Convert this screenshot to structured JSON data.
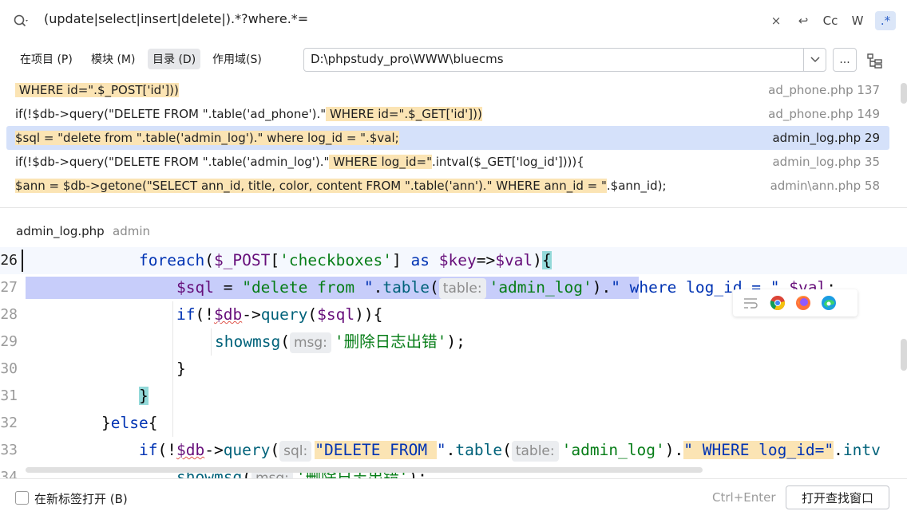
{
  "search": {
    "query": "(update|select|insert|delete|).*?where.*=",
    "actions": {
      "clear": "×",
      "replace": "↩",
      "match_case": "Cc",
      "whole_words": "W",
      "regex": ".*"
    }
  },
  "scope": {
    "tabs": [
      {
        "label": "在项目 (P)",
        "selected": false
      },
      {
        "label": "模块 (M)",
        "selected": false
      },
      {
        "label": "目录 (D)",
        "selected": true
      },
      {
        "label": "作用域(S)",
        "selected": false
      }
    ],
    "directory": "D:\\phpstudy_pro\\WWW\\bluecms",
    "browse_label": "..."
  },
  "results": [
    {
      "pre": "",
      "hl": " WHERE id=\".$_POST['id']))",
      "post": "",
      "file": "ad_phone.php 137",
      "selected": false
    },
    {
      "pre": "if(!$db->query(\"DELETE FROM \".table('ad_phone').\"",
      "hl": " WHERE id=\".$_GET['id']))",
      "post": "",
      "file": "ad_phone.php 149",
      "selected": false
    },
    {
      "pre": "",
      "hl": "$sql = \"delete from \".table('admin_log').\" where log_id = \".$val;",
      "post": "",
      "file": "admin_log.php 29",
      "selected": true
    },
    {
      "pre": "if(!$db->query(\"DELETE FROM \".table('admin_log').\"",
      "hl": " WHERE log_id=\"",
      "post": ".intval($_GET['log_id']))){",
      "file": "admin_log.php 35",
      "selected": false
    },
    {
      "pre": "",
      "hl": "$ann = $db->getone(\"SELECT ann_id, title, color, content FROM \".table('ann').\" WHERE ann_id = \"",
      "post": ".$ann_id);",
      "file": "admin\\ann.php 58",
      "selected": false
    }
  ],
  "preview": {
    "file": "admin_log.php",
    "dir": "admin"
  },
  "editor": {
    "lines": [
      {
        "num": "26",
        "current": true
      },
      {
        "num": "27"
      },
      {
        "num": "28"
      },
      {
        "num": "29"
      },
      {
        "num": "30"
      },
      {
        "num": "31"
      },
      {
        "num": "32"
      },
      {
        "num": "33"
      },
      {
        "num": "34"
      }
    ],
    "tokens": {
      "l26_foreach": "foreach",
      "l26_a": "(",
      "l26_post": "$_POST",
      "l26_b": "[",
      "l26_str": "'checkboxes'",
      "l26_c": "] ",
      "l26_as": "as",
      "l26_d": " ",
      "l26_key": "$key",
      "l26_e": "=>",
      "l26_val": "$val",
      "l26_f": ")",
      "l26_brace": "{",
      "l27_sql": "$sql",
      "l27_eq": " = ",
      "l27_str1": "\"delete from ",
      "l27_str1b": "\"",
      "l27_dot": ".",
      "l27_table": "table",
      "l27_p": "(",
      "l27_hint": "table:",
      "l27_str2": "'admin_log'",
      "l27_q": ").",
      "l27_str3": "\" where log_id = \"",
      "l27_dot2": ".",
      "l27_val": "$val",
      "l27_semi": ";",
      "l28_if": "if",
      "l28_a": "(!",
      "l28_db": "$db",
      "l28_arrow": "->",
      "l28_query": "query",
      "l28_b": "(",
      "l28_sql": "$sql",
      "l28_c": ")){",
      "l29_fn": "showmsg",
      "l29_a": "(",
      "l29_hint": "msg:",
      "l29_str": "'删除日志出错'",
      "l29_b": ");",
      "l30_brace": "}",
      "l31_brace": "}",
      "l32_a": "}",
      "l32_else": "else",
      "l32_b": "{",
      "l33_if": "if",
      "l33_a": "(!",
      "l33_db": "$db",
      "l33_arrow": "->",
      "l33_query": "query",
      "l33_b": "(",
      "l33_hint": "sql:",
      "l33_str": "\"DELETE FROM ",
      "l33_str_b": "\"",
      "l33_dot": ".",
      "l33_table": "table",
      "l33_c": "(",
      "l33_hint2": "table:",
      "l33_str2": "'admin_log'",
      "l33_d": ").",
      "l33_str3": "\" WHERE log_id=\"",
      "l33_dot2": ".",
      "l33_intv": "intv",
      "l34_fn": "showmsg",
      "l34_a": "(",
      "l34_hint": "msg:",
      "l34_str": "'删除日志出错'",
      "l34_b": ");"
    }
  },
  "footer": {
    "checkbox_label": "在新标签打开 (B)",
    "shortcut": "Ctrl+Enter",
    "open_button": "打开查找窗口"
  },
  "colors": {
    "match_highlight": "#fbe4b4",
    "selected_row": "#d5e1fa",
    "editor_match": "#c7cdfa",
    "keyword": "#0033b3",
    "string": "#067d17"
  }
}
